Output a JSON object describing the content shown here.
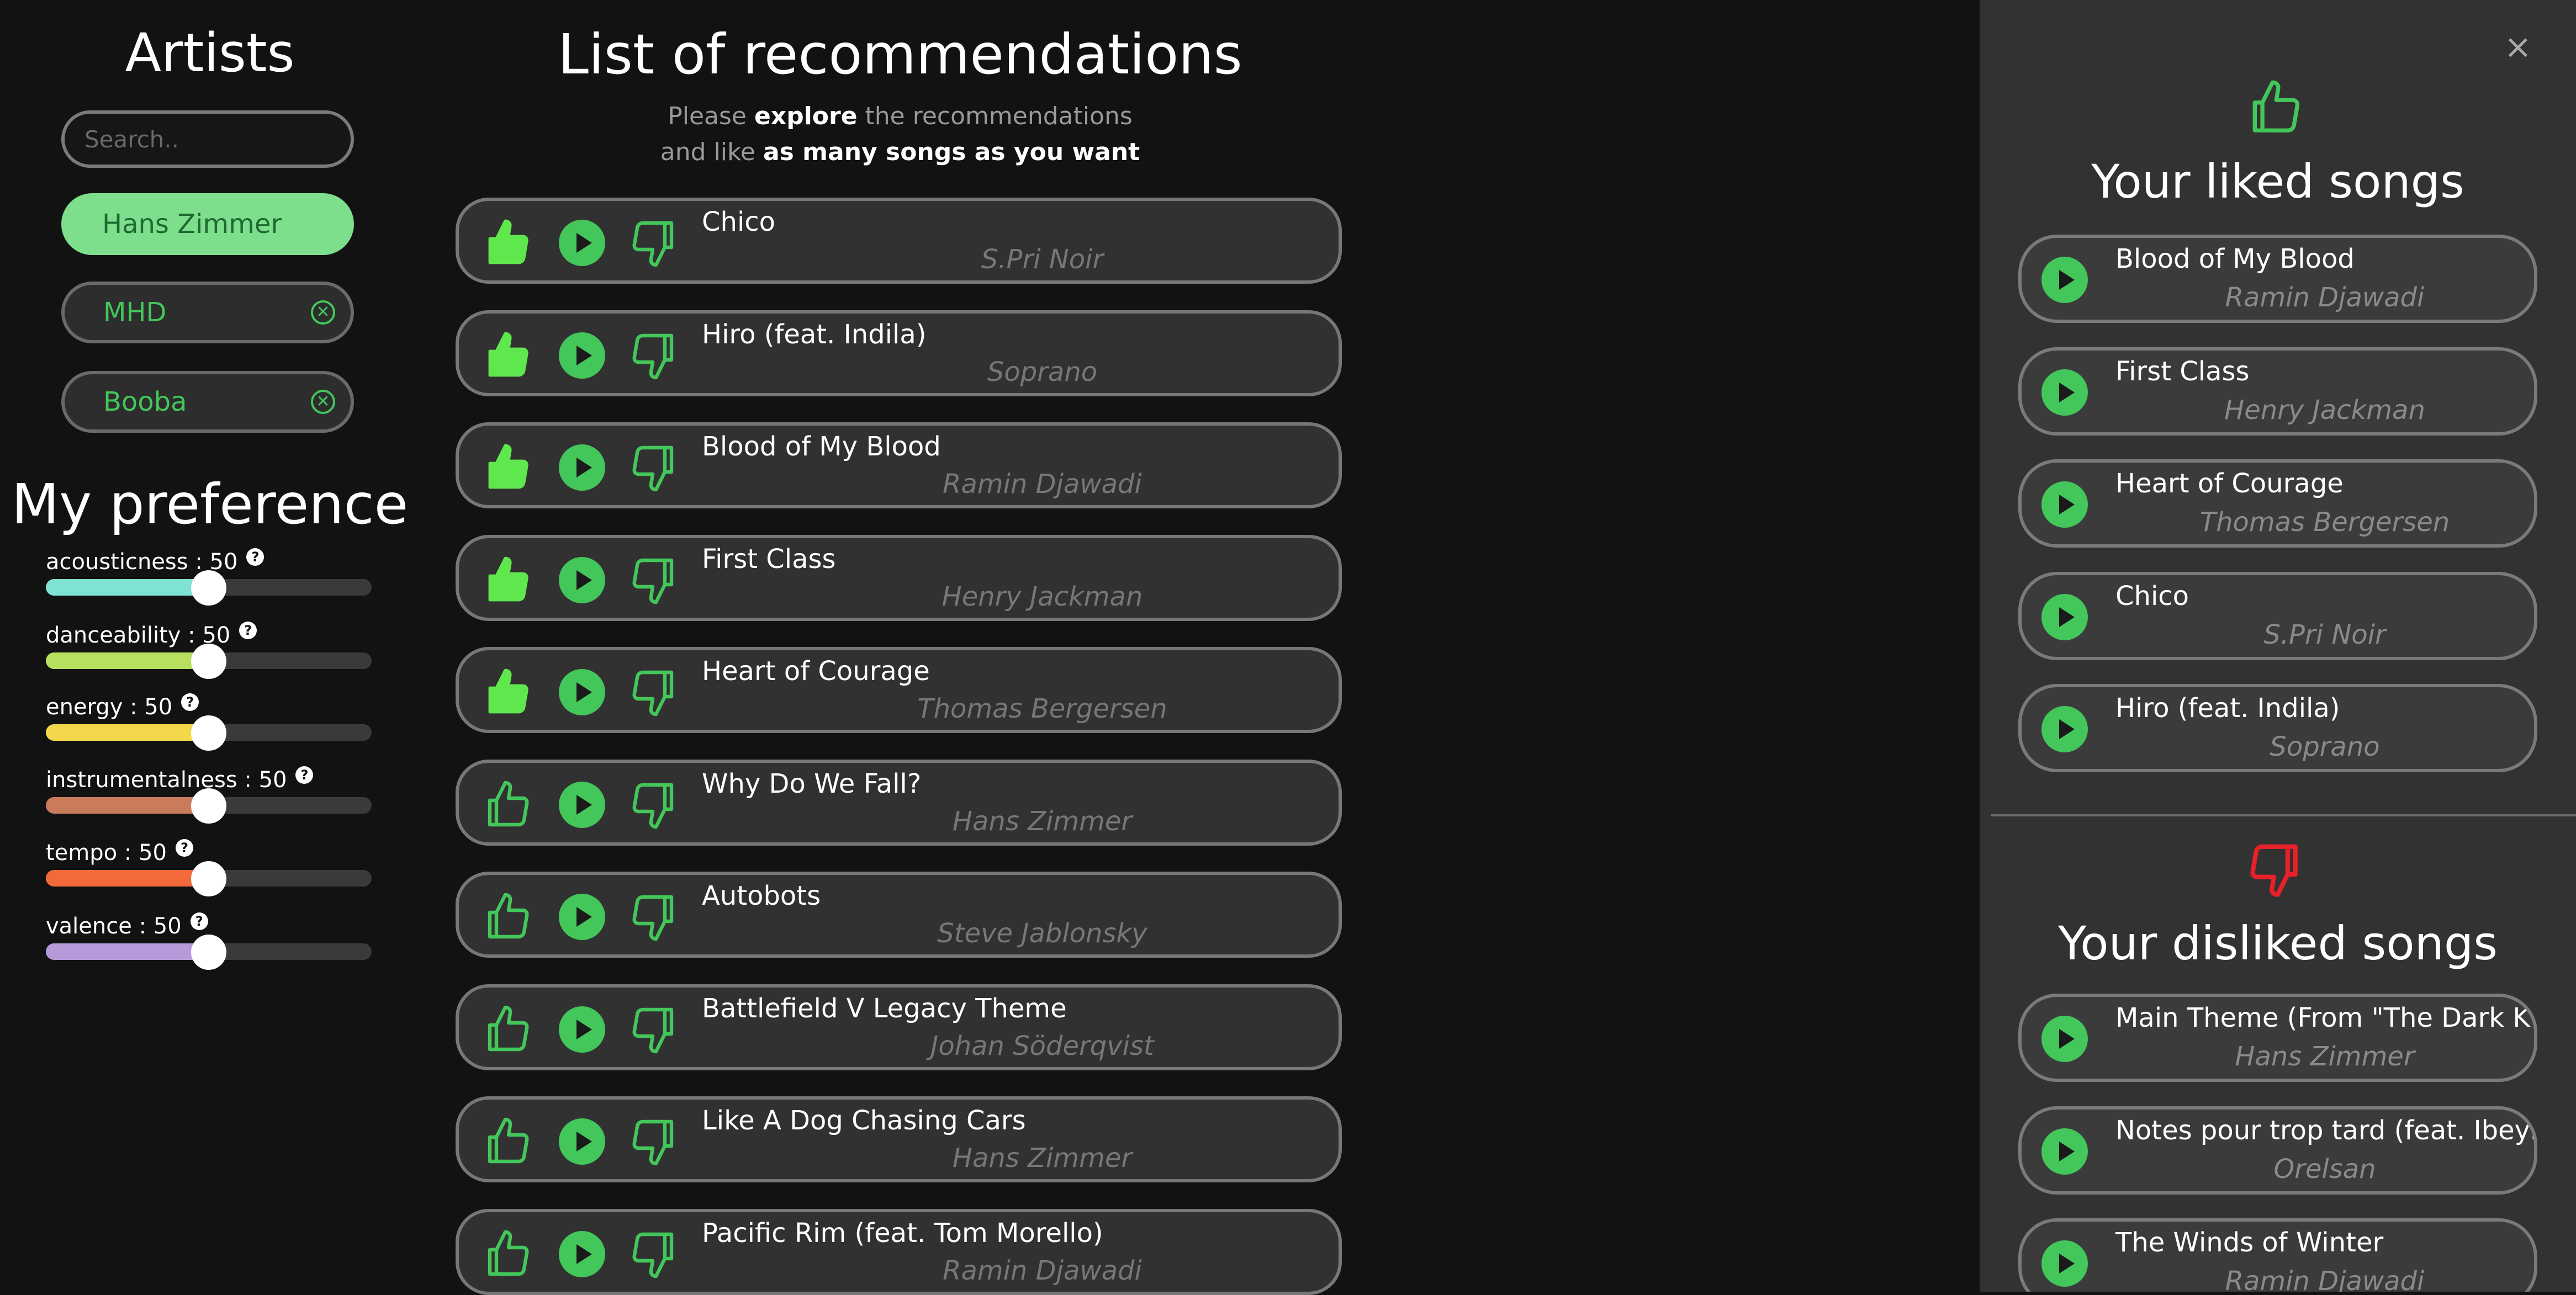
{
  "artists": {
    "title": "Artists",
    "search_placeholder": "Search..",
    "chips": [
      {
        "label": "Hans Zimmer",
        "selected": true
      },
      {
        "label": "MHD",
        "selected": false
      },
      {
        "label": "Booba",
        "selected": false
      }
    ]
  },
  "preferences": {
    "title": "My preference",
    "sliders": [
      {
        "label": "acousticness : 50",
        "value": 50,
        "color": "#7fe3d2"
      },
      {
        "label": "danceability : 50",
        "value": 50,
        "color": "#b8e060"
      },
      {
        "label": "energy : 50",
        "value": 50,
        "color": "#f2d84a"
      },
      {
        "label": "instrumentalness : 50",
        "value": 50,
        "color": "#c97b5c"
      },
      {
        "label": "tempo : 50",
        "value": 50,
        "color": "#f26a3c"
      },
      {
        "label": "valence : 50",
        "value": 50,
        "color": "#b49ad8"
      }
    ],
    "help_glyph": "?"
  },
  "recommendations": {
    "title": "List of recommendations",
    "subtitle_line1": [
      "Please ",
      "explore",
      " the recommendations"
    ],
    "subtitle_line2": [
      "and like ",
      "as many songs as you want"
    ],
    "items": [
      {
        "title": "Chico",
        "artist": "S.Pri Noir",
        "liked": true
      },
      {
        "title": "Hiro (feat. Indila)",
        "artist": "Soprano",
        "liked": true
      },
      {
        "title": "Blood of My Blood",
        "artist": "Ramin Djawadi",
        "liked": true
      },
      {
        "title": "First Class",
        "artist": "Henry Jackman",
        "liked": true
      },
      {
        "title": "Heart of Courage",
        "artist": "Thomas Bergersen",
        "liked": true
      },
      {
        "title": "Why Do We Fall?",
        "artist": "Hans Zimmer",
        "liked": false
      },
      {
        "title": "Autobots",
        "artist": "Steve Jablonsky",
        "liked": false
      },
      {
        "title": "Battlefield V Legacy Theme",
        "artist": "Johan Söderqvist",
        "liked": false
      },
      {
        "title": "Like A Dog Chasing Cars",
        "artist": "Hans Zimmer",
        "liked": false
      },
      {
        "title": "Pacific Rim (feat. Tom Morello)",
        "artist": "Ramin Djawadi",
        "liked": false
      }
    ]
  },
  "panel": {
    "close_glyph": "×",
    "liked_title": "Your liked songs",
    "liked": [
      {
        "title": "Blood of My Blood",
        "artist": "Ramin Djawadi"
      },
      {
        "title": "First Class",
        "artist": "Henry Jackman"
      },
      {
        "title": "Heart of Courage",
        "artist": "Thomas Bergersen"
      },
      {
        "title": "Chico",
        "artist": "S.Pri Noir"
      },
      {
        "title": "Hiro (feat. Indila)",
        "artist": "Soprano"
      }
    ],
    "disliked_title": "Your disliked songs",
    "disliked": [
      {
        "title": "Main Theme (From \"The Dark K",
        "artist": "Hans Zimmer"
      },
      {
        "title": "Notes pour trop tard (feat. Ibeyi",
        "artist": "Orelsan"
      },
      {
        "title": "The Winds of Winter",
        "artist": "Ramin Djawadi"
      }
    ]
  },
  "colors": {
    "accent_green": "#43c65a",
    "like_green_filled": "#5fe84e",
    "dislike_red": "#e8202a",
    "background": "#121212",
    "panel_bg": "#323232"
  }
}
